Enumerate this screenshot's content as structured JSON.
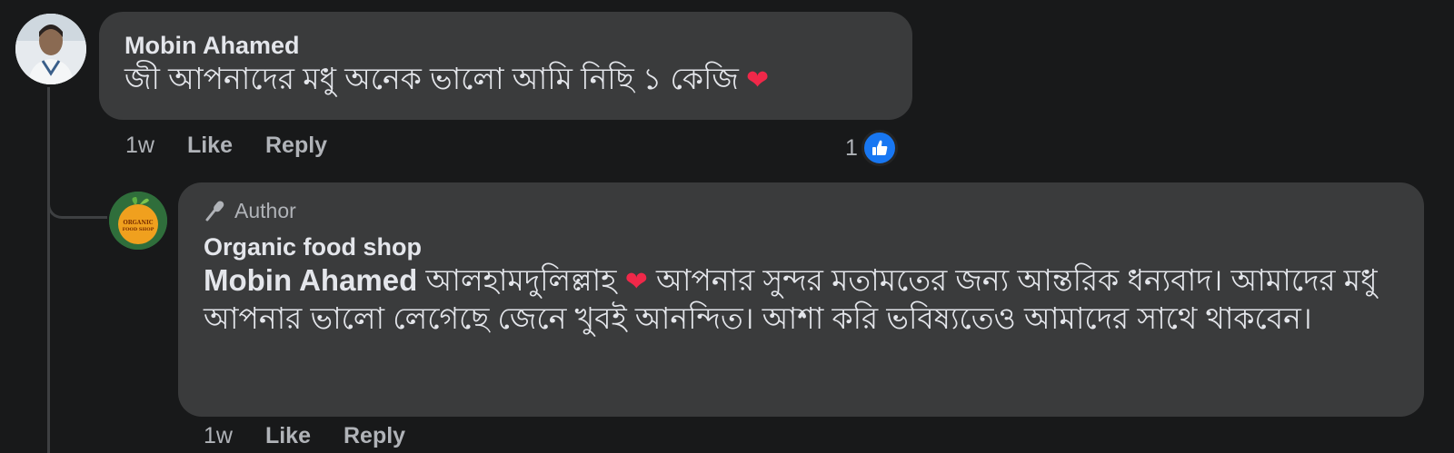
{
  "comment": {
    "author": "Mobin Ahamed",
    "text": "জী আপনাদের মধু অনেক ভালো আমি নিছি ১ কেজি",
    "time": "1w",
    "like_label": "Like",
    "reply_label": "Reply",
    "reaction_count": "1",
    "reaction_icon": "like-thumb-icon",
    "heart_icon": "red-heart-icon"
  },
  "reply": {
    "badge_label": "Author",
    "badge_icon": "microphone-icon",
    "author": "Organic food shop",
    "mention": "Mobin Ahamed",
    "text_part1": " আলহামদুলিল্লাহ ",
    "text_part2": " আপনার সুন্দর মতামতের জন্য আন্তরিক ধন্যবাদ। আমাদের মধু আপনার ভালো লেগেছে জেনে খুবই আনন্দিত। আশা করি ভবিষ্যতেও আমাদের সাথে থাকবেন।",
    "avatar_logo_text": "ORGANIC FOOD SHOP",
    "time": "1w",
    "like_label": "Like",
    "reply_label": "Reply"
  },
  "colors": {
    "background": "#18191a",
    "bubble": "#3a3b3c",
    "text": "#e4e6eb",
    "muted": "#b0b3b8",
    "like_blue": "#1877f2",
    "heart_red": "#f02849"
  }
}
